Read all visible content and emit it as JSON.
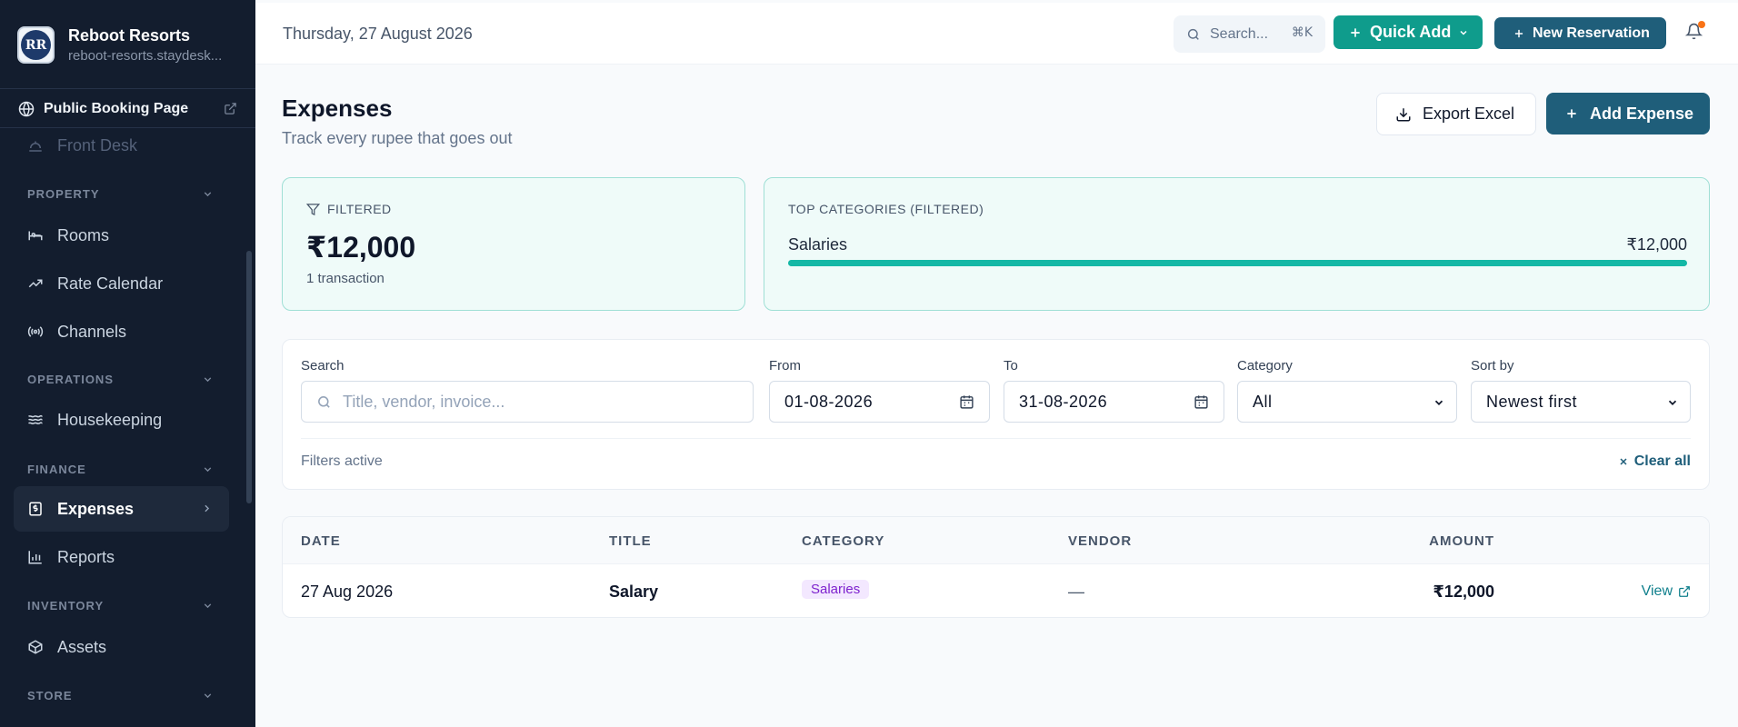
{
  "app": {
    "name": "Reboot Resorts",
    "url": "reboot-resorts.staydesk...",
    "logo_text": "RR"
  },
  "sidebar": {
    "public_link": "Public Booking Page",
    "items": {
      "front_desk": "Front Desk",
      "rooms": "Rooms",
      "rate_calendar": "Rate Calendar",
      "channels": "Channels",
      "housekeeping": "Housekeeping",
      "expenses": "Expenses",
      "reports": "Reports",
      "assets": "Assets"
    },
    "sections": {
      "property": "PROPERTY",
      "operations": "OPERATIONS",
      "finance": "FINANCE",
      "inventory": "INVENTORY",
      "store": "STORE"
    },
    "active_item": "Expenses"
  },
  "topbar": {
    "date": "Thursday, 27 August 2026",
    "search_placeholder": "Search...",
    "search_shortcut": "⌘K",
    "quick_add": "Quick Add",
    "new_reservation": "New Reservation"
  },
  "page": {
    "title": "Expenses",
    "subtitle": "Track every rupee that goes out",
    "export_label": "Export Excel",
    "add_label": "Add Expense"
  },
  "stats": {
    "filtered_label": "FILTERED",
    "filtered_total": "₹12,000",
    "filtered_count": "1 transaction",
    "top_categories_label": "TOP CATEGORIES (FILTERED)",
    "top_categories": [
      {
        "name": "Salaries",
        "amount": "₹12,000",
        "share": 1.0
      }
    ]
  },
  "filters": {
    "search_label": "Search",
    "search_placeholder": "Title, vendor, invoice...",
    "from_label": "From",
    "from_value": "01-08-2026",
    "to_label": "To",
    "to_value": "31-08-2026",
    "category_label": "Category",
    "category_value": "All",
    "sort_label": "Sort by",
    "sort_value": "Newest first",
    "status": "Filters active",
    "clear_label": "Clear all"
  },
  "table": {
    "columns": {
      "date": "DATE",
      "title": "TITLE",
      "category": "CATEGORY",
      "vendor": "VENDOR",
      "amount": "AMOUNT"
    },
    "rows": [
      {
        "date": "27 Aug 2026",
        "title": "Salary",
        "category": "Salaries",
        "vendor": "—",
        "amount": "₹12,000",
        "action": "View"
      }
    ]
  },
  "colors": {
    "sidebar_bg": "#131d2e",
    "primary": "#1f5e7a",
    "accent_teal": "#0f9c8c",
    "progress": "#14b8a6",
    "badge_bg": "#f3e8ff",
    "badge_text": "#7e22ce",
    "notification_dot": "#f97316"
  }
}
